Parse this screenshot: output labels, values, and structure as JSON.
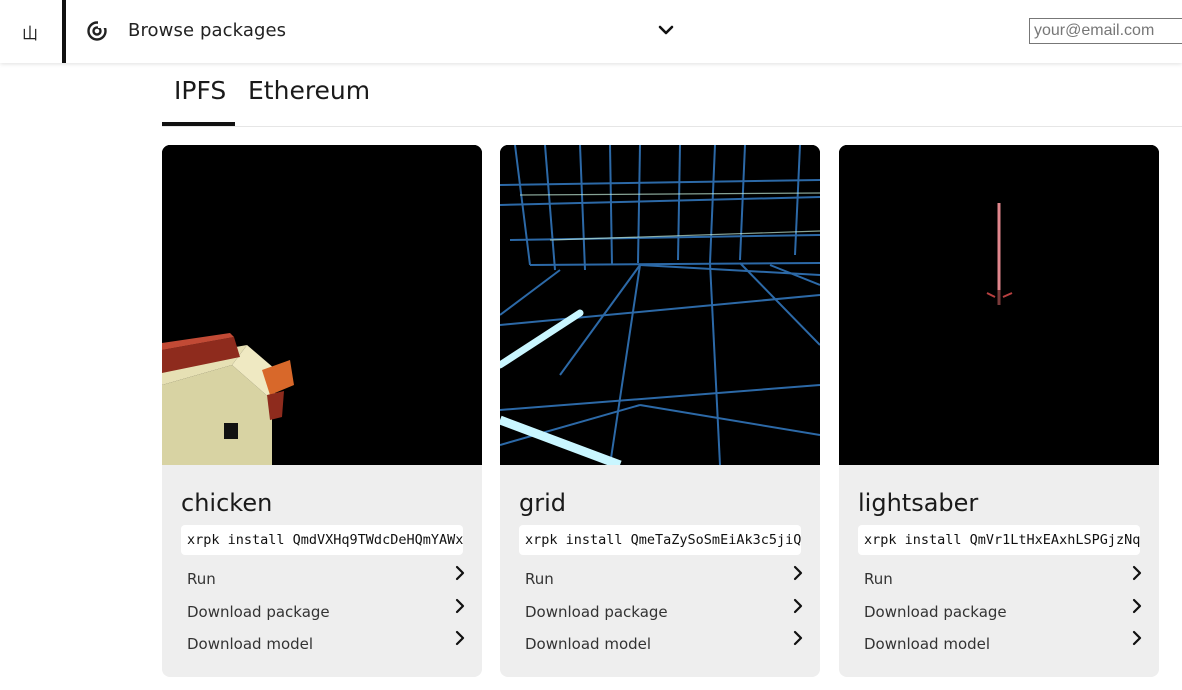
{
  "header": {
    "logo_glyph": "山",
    "browse_label": "Browse packages",
    "browse_icon": "orbit-icon",
    "dropdown_icon": "chevron-down-icon",
    "email_placeholder": "your@email.com",
    "email_value": ""
  },
  "tabs": [
    {
      "label": "IPFS",
      "active": true
    },
    {
      "label": "Ethereum",
      "active": false
    }
  ],
  "cards": [
    {
      "title": "chicken",
      "command": "xrpk install QmdVXHq9TWdcDeHQmYAWx",
      "actions": [
        "Run",
        "Download package",
        "Download model"
      ]
    },
    {
      "title": "grid",
      "command": "xrpk install QmeTaZySoSmEiAk3c5jiQ",
      "actions": [
        "Run",
        "Download package",
        "Download model"
      ]
    },
    {
      "title": "lightsaber",
      "command": "xrpk install QmVr1LtHxEAxhLSPGjzNq",
      "actions": [
        "Run",
        "Download package",
        "Download model"
      ]
    }
  ],
  "colors": {
    "card_bg": "#eeeeee",
    "preview_bg": "#000000",
    "accent": "#111111"
  }
}
